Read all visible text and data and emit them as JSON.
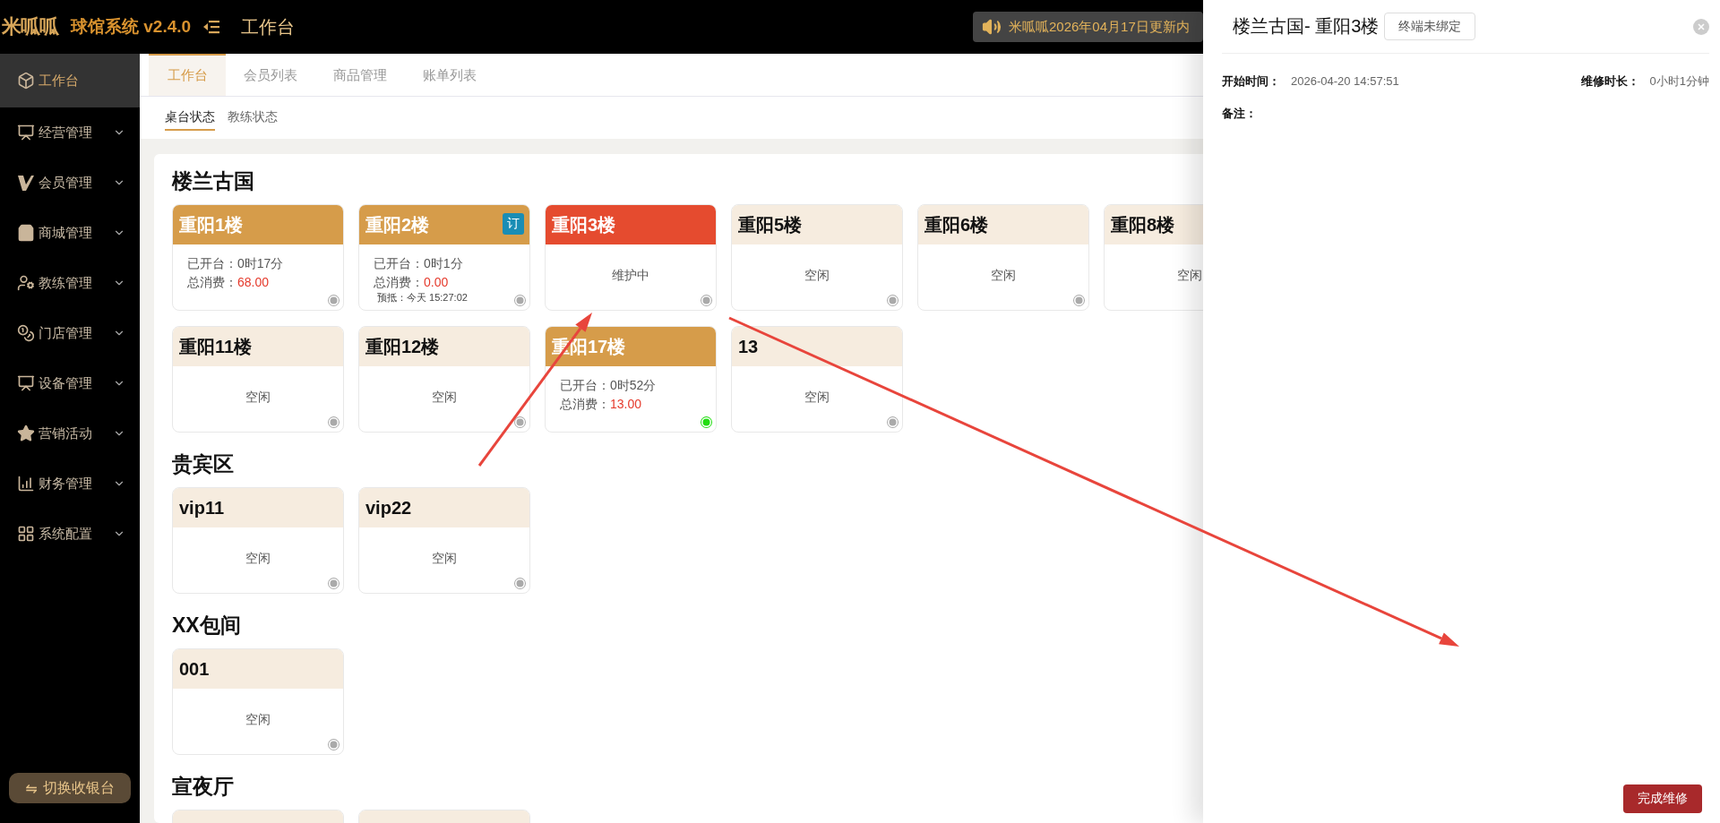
{
  "header": {
    "logo": "米呱呱",
    "app_name": "球馆系统 v2.4.0",
    "page_title": "工作台",
    "notice": "米呱呱2026年04月17日更新内"
  },
  "sidebar": {
    "items": [
      {
        "label": "工作台",
        "kind": "link",
        "selected": true
      },
      {
        "label": "经营管理",
        "kind": "group",
        "selected": false,
        "expanded": false
      },
      {
        "label": "会员管理",
        "kind": "group",
        "selected": false,
        "expanded": false
      },
      {
        "label": "商城管理",
        "kind": "group",
        "selected": false,
        "expanded": false
      },
      {
        "label": "教练管理",
        "kind": "group",
        "selected": false,
        "expanded": false
      },
      {
        "label": "门店管理",
        "kind": "group",
        "selected": false,
        "expanded": false
      },
      {
        "label": "设备管理",
        "kind": "group",
        "selected": false,
        "expanded": false
      },
      {
        "label": "营销活动",
        "kind": "group",
        "selected": false,
        "expanded": false
      },
      {
        "label": "财务管理",
        "kind": "group",
        "selected": false,
        "expanded": false
      },
      {
        "label": "系统配置",
        "kind": "group",
        "selected": false,
        "expanded": false
      }
    ],
    "switch_button": {
      "icon": "⇋",
      "label": "切换收银台"
    }
  },
  "tabs": [
    {
      "label": "工作台",
      "selected": true
    },
    {
      "label": "会员列表",
      "selected": false
    },
    {
      "label": "商品管理",
      "selected": false
    },
    {
      "label": "账单列表",
      "selected": false
    }
  ],
  "sub_tabs": [
    {
      "label": "桌台状态",
      "selected": true
    },
    {
      "label": "教练状态",
      "selected": false
    }
  ],
  "sections": [
    {
      "title": "楼兰古国",
      "rows": [
        [
          {
            "name": "重阳1楼",
            "kind": "in_use",
            "color": "#aaaaaa",
            "lines": [
              {
                "label": "已开台：",
                "value": "0时17分",
                "kind": "time"
              },
              {
                "label": "总消费：",
                "value": "68.00",
                "kind": "money"
              }
            ]
          },
          {
            "name": "重阳2楼",
            "kind": "in_use",
            "badge": "订",
            "color": "#aaaaaa",
            "lines": [
              {
                "label": "已开台：",
                "value": "0时1分",
                "kind": "time"
              },
              {
                "label": "总消费：",
                "value": "0.00",
                "kind": "money"
              }
            ],
            "reservation": "预抵：今天 15:27:02"
          },
          {
            "name": "重阳3楼",
            "kind": "maintenance",
            "color": "#aaaaaa",
            "status": "维护中"
          },
          {
            "name": "重阳5楼",
            "kind": "idle",
            "color": "#aaaaaa",
            "status": "空闲"
          },
          {
            "name": "重阳6楼",
            "kind": "idle",
            "color": "#aaaaaa",
            "status": "空闲"
          },
          {
            "name": "重阳8楼",
            "kind": "idle",
            "status": "空闲"
          }
        ],
        [
          {
            "name": "重阳11楼",
            "kind": "idle",
            "color": "#aaaaaa",
            "status": "空闲"
          },
          {
            "name": "重阳12楼",
            "kind": "idle",
            "color": "#aaaaaa",
            "status": "空闲"
          },
          {
            "name": "重阳17楼",
            "kind": "in_use",
            "color": "#22dd11",
            "lines": [
              {
                "label": "已开台：",
                "value": "0时52分",
                "kind": "time"
              },
              {
                "label": "总消费：",
                "value": "13.00",
                "kind": "money"
              }
            ]
          },
          {
            "name": "13",
            "kind": "idle",
            "color": "#aaaaaa",
            "status": "空闲"
          }
        ]
      ]
    },
    {
      "title": "贵宾区",
      "rows": [
        [
          {
            "name": "vip11",
            "kind": "idle",
            "color": "#aaaaaa",
            "status": "空闲"
          },
          {
            "name": "vip22",
            "kind": "idle",
            "color": "#aaaaaa",
            "status": "空闲"
          }
        ]
      ]
    },
    {
      "title": "XX包间",
      "rows": [
        [
          {
            "name": "001",
            "kind": "idle",
            "color": "#aaaaaa",
            "status": "空闲"
          }
        ]
      ]
    },
    {
      "title": "宣夜厅",
      "rows": [
        [
          {
            "kind": "idle"
          },
          {
            "kind": "idle"
          }
        ]
      ]
    }
  ],
  "drawer": {
    "title": "楼兰古国- 重阳3楼",
    "terminal_tag": "终端未绑定",
    "fields": [
      {
        "label": "开始时间：",
        "value": "2026-04-20 14:57:51"
      },
      {
        "label": "维修时长：",
        "value": "0小时1分钟"
      }
    ],
    "remark_label": "备注：",
    "action": "完成维修"
  },
  "annotations": [
    {
      "kind": "arrow"
    },
    {
      "kind": "arrow"
    }
  ]
}
